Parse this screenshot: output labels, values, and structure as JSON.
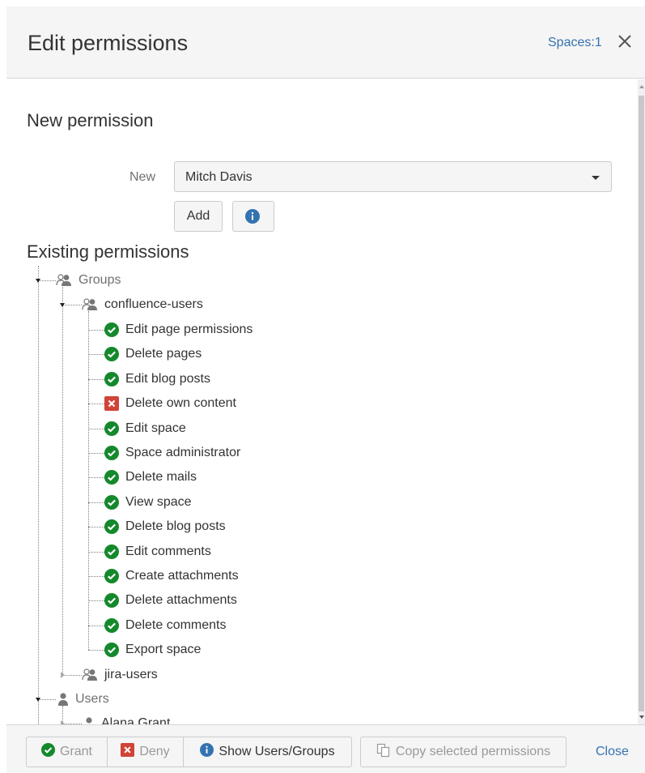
{
  "header": {
    "title": "Edit permissions",
    "spaces_link": "Spaces:1"
  },
  "new_permission": {
    "title": "New permission",
    "label": "New",
    "selected_user": "Mitch Davis",
    "add_label": "Add"
  },
  "existing": {
    "title": "Existing permissions",
    "groups_label": "Groups",
    "confluence_group": "confluence-users",
    "permissions": [
      {
        "label": "Edit page permissions",
        "status": "granted"
      },
      {
        "label": "Delete pages",
        "status": "granted"
      },
      {
        "label": "Edit blog posts",
        "status": "granted"
      },
      {
        "label": "Delete own content",
        "status": "denied"
      },
      {
        "label": "Edit space",
        "status": "granted"
      },
      {
        "label": "Space administrator",
        "status": "granted"
      },
      {
        "label": "Delete mails",
        "status": "granted"
      },
      {
        "label": "View space",
        "status": "granted"
      },
      {
        "label": "Delete blog posts",
        "status": "granted"
      },
      {
        "label": "Edit comments",
        "status": "granted"
      },
      {
        "label": "Create attachments",
        "status": "granted"
      },
      {
        "label": "Delete attachments",
        "status": "granted"
      },
      {
        "label": "Delete comments",
        "status": "granted"
      },
      {
        "label": "Export space",
        "status": "granted"
      }
    ],
    "jira_group": "jira-users",
    "users_label": "Users",
    "users": [
      "Alana Grant"
    ]
  },
  "footer": {
    "grant_label": "Grant",
    "deny_label": "Deny",
    "show_label": "Show Users/Groups",
    "copy_label": "Copy selected permissions",
    "close_label": "Close"
  },
  "colors": {
    "granted": "#14892c",
    "denied": "#d04437",
    "info": "#3572b0",
    "link": "#3572b0"
  },
  "icons": {
    "granted": "check-circle-icon",
    "denied": "x-square-icon",
    "group": "group-icon",
    "user": "user-icon",
    "info": "info-icon",
    "copy": "copy-icon",
    "close": "close-icon"
  }
}
